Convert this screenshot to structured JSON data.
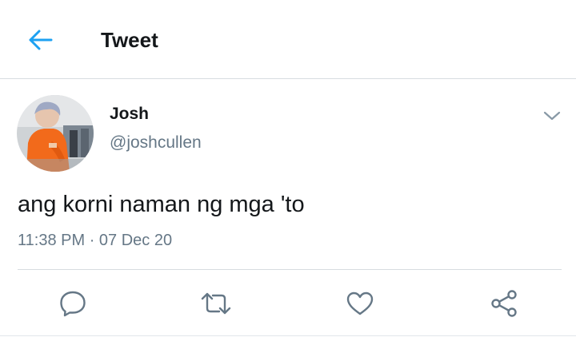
{
  "colors": {
    "accent": "#1da1f2",
    "text_primary": "#14171a",
    "text_secondary": "#657786",
    "divider": "#d7dce0"
  },
  "header": {
    "back_icon": "arrow-left-icon",
    "title": "Tweet"
  },
  "tweet": {
    "author": {
      "name": "Josh",
      "handle": "@joshcullen",
      "avatar": "profile-photo"
    },
    "menu_icon": "chevron-down-icon",
    "text": "ang korni naman ng mga 'to",
    "time": "11:38 PM",
    "separator": "·",
    "date": "07 Dec 20"
  },
  "actions": [
    {
      "name": "reply",
      "icon": "reply-icon"
    },
    {
      "name": "retweet",
      "icon": "retweet-icon"
    },
    {
      "name": "like",
      "icon": "heart-icon"
    },
    {
      "name": "share",
      "icon": "share-icon"
    }
  ]
}
